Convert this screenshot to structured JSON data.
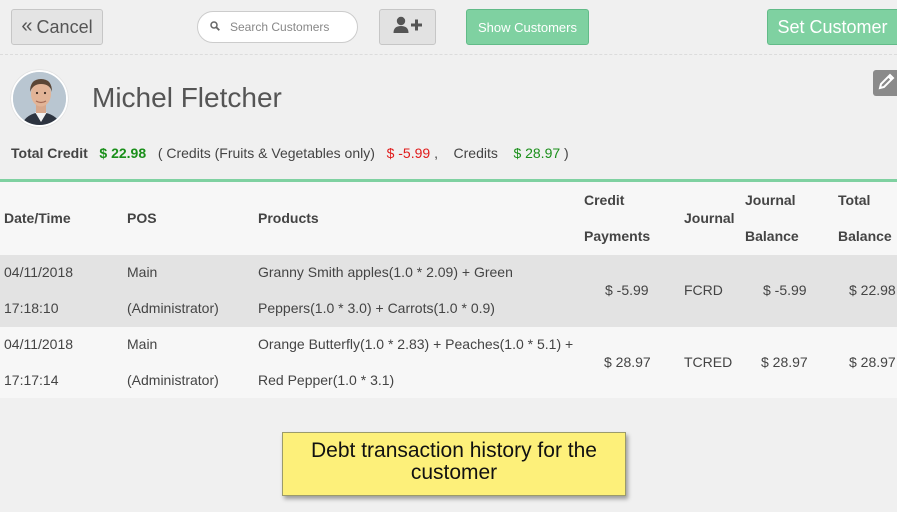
{
  "toolbar": {
    "cancel_label": "Cancel",
    "search_placeholder": "Search Customers",
    "show_customers_label": "Show Customers",
    "set_customer_label": "Set Customer"
  },
  "customer": {
    "name": "Michel Fletcher",
    "total_credit_label": "Total Credit",
    "total_credit_value": "$ 22.98",
    "credits_fv_label": "( Credits (Fruits & Vegetables only)",
    "credits_fv_value": "$ -5.99",
    "separator": ",",
    "credits_label": "Credits",
    "credits_value": "$ 28.97",
    "close_paren": ")"
  },
  "table": {
    "headers": {
      "datetime": "Date/Time",
      "pos": "POS",
      "products": "Products",
      "credit_payments_1": "Credit",
      "credit_payments_2": "Payments",
      "journal": "Journal",
      "journal_balance_1": "Journal",
      "journal_balance_2": "Balance",
      "total_balance_1": "Total",
      "total_balance_2": "Balance"
    },
    "rows": [
      {
        "date": "04/11/2018",
        "time": "17:18:10",
        "pos_1": "Main",
        "pos_2": "(Administrator)",
        "products_1": "Granny Smith apples(1.0 * 2.09) + Green",
        "products_2": "Peppers(1.0 * 3.0) + Carrots(1.0 * 0.9)",
        "credit_payment": "$ -5.99",
        "journal": "FCRD",
        "journal_balance": "$ -5.99",
        "total_balance": "$ 22.98"
      },
      {
        "date": "04/11/2018",
        "time": "17:17:14",
        "pos_1": "Main",
        "pos_2": "(Administrator)",
        "products_1": "Orange Butterfly(1.0 * 2.83) + Peaches(1.0 * 5.1) +",
        "products_2": "Red Pepper(1.0 * 3.1)",
        "credit_payment": "$ 28.97",
        "journal": "TCRED",
        "journal_balance": "$ 28.97",
        "total_balance": "$ 28.97"
      }
    ]
  },
  "callout": {
    "line1": "Debt transaction history for the",
    "line2": "customer"
  },
  "colors": {
    "accent_green": "#7fd1a1",
    "positive": "#1a8f1a",
    "negative": "#e01b1b",
    "callout_bg": "#fdf07a"
  },
  "icons": [
    "double-chevron-left-icon",
    "search-icon",
    "add-user-icon",
    "pencil-icon"
  ]
}
